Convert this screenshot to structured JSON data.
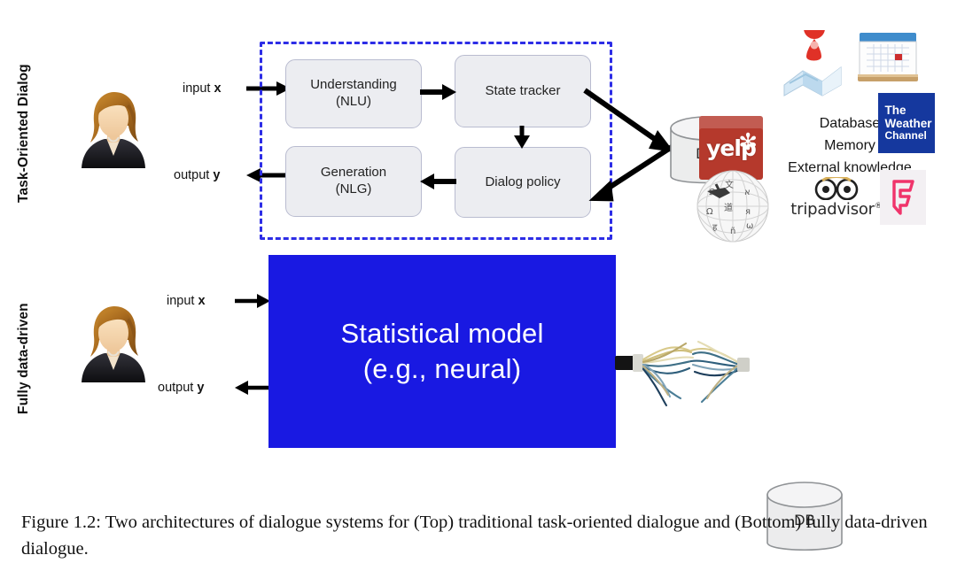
{
  "figure": {
    "caption": "Figure 1.2: Two architectures of dialogue systems for (Top) traditional task-oriented dialogue and (Bottom) fully data-driven dialogue."
  },
  "colors": {
    "dashed_border": "#2d2de6",
    "blue_box": "#1919e2",
    "process_box_fill": "#ecedf1",
    "process_box_border": "#b9bcd0",
    "yelp_red": "#b5392c",
    "weather_blue": "#15389e",
    "foursquare_pink": "#f0346b",
    "map_pin_red": "#e03127"
  },
  "top_section": {
    "label": "Task-Oriented Dialog",
    "user_avatar_name": "user-avatar",
    "input_label_prefix": "input ",
    "input_label_var": "x",
    "output_label_prefix": "output ",
    "output_label_var": "y",
    "pipeline_boxes": [
      {
        "id": "nlu",
        "line1": "Understanding",
        "line2": "(NLU)"
      },
      {
        "id": "state-tracker",
        "line1": "State tracker",
        "line2": ""
      },
      {
        "id": "dialog-policy",
        "line1": "Dialog policy",
        "line2": ""
      },
      {
        "id": "nlg",
        "line1": "Generation",
        "line2": "(NLG)"
      }
    ],
    "database": {
      "label": "DB"
    },
    "knowledge_sources": [
      "Database",
      "Memory",
      "External knowledge"
    ],
    "logos": [
      {
        "id": "yelp",
        "text": "yelp"
      },
      {
        "id": "maps",
        "text": ""
      },
      {
        "id": "calendar",
        "text": ""
      },
      {
        "id": "weather-channel",
        "line1": "The",
        "line2": "Weather",
        "line3": "Channel"
      },
      {
        "id": "wikipedia",
        "text": ""
      },
      {
        "id": "tripadvisor",
        "text": "tripadvisor",
        "registered": "®"
      },
      {
        "id": "foursquare",
        "text": ""
      }
    ]
  },
  "bottom_section": {
    "label": "Fully data-driven",
    "user_avatar_name": "user-avatar",
    "input_label_prefix": "input ",
    "input_label_var": "x",
    "output_label_prefix": "output ",
    "output_label_var": "y",
    "model_box": {
      "line1": "Statistical model",
      "line2": "(e.g., neural)"
    },
    "database": {
      "label": "DB"
    },
    "connector_name": "frayed-cable-bundle"
  }
}
